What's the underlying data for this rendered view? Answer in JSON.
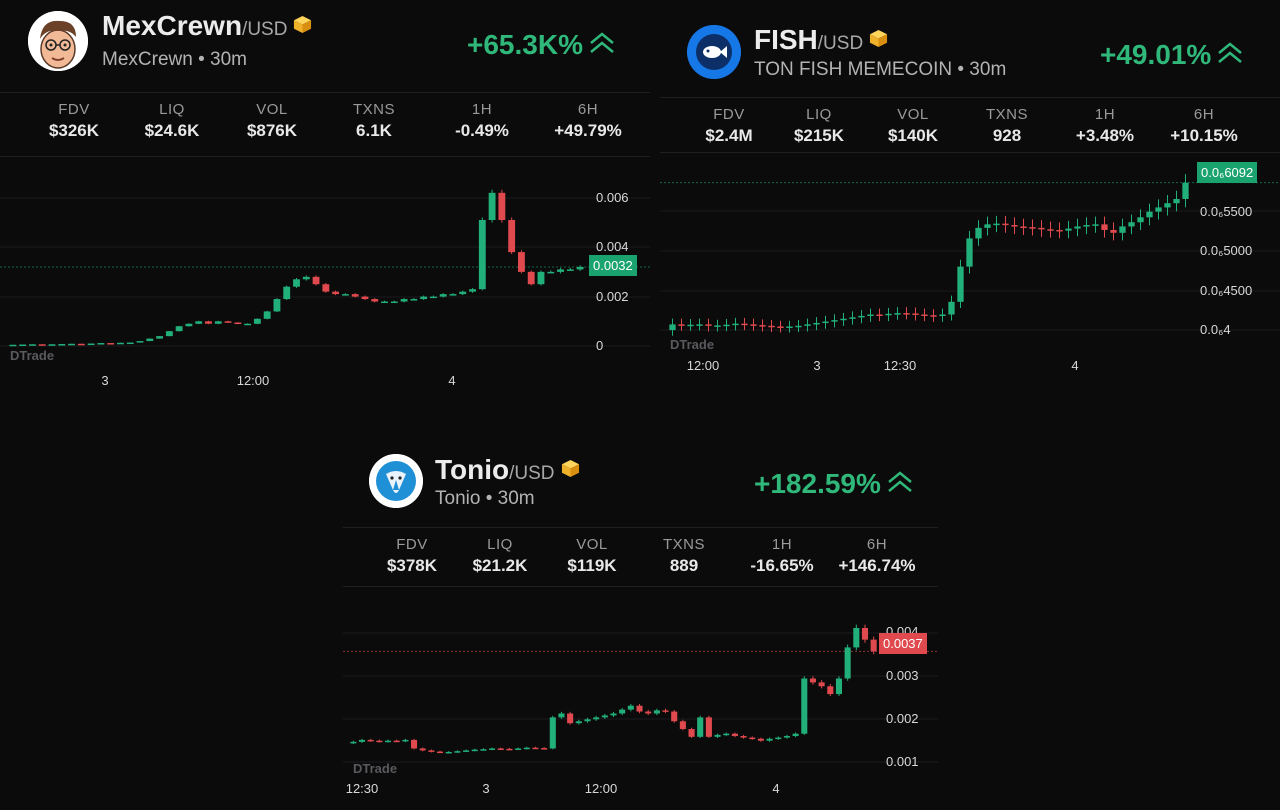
{
  "cards": [
    {
      "id": "mexcrewn",
      "name": "MexCrewn",
      "unit": "/USD",
      "subtitle": "MexCrewn • 30m",
      "change": "+65.3K%",
      "stats": [
        {
          "label": "FDV",
          "value": "$326K"
        },
        {
          "label": "LIQ",
          "value": "$24.6K"
        },
        {
          "label": "VOL",
          "value": "$876K"
        },
        {
          "label": "TXNS",
          "value": "6.1K"
        },
        {
          "label": "1H",
          "value": "-0.49%"
        },
        {
          "label": "6H",
          "value": "+49.79%"
        }
      ],
      "watermark": "DTrade",
      "price_tag": "0.0032",
      "price_tag_color": "#1aa36f",
      "y_labels": [
        "0.006",
        "0.004",
        "0.002",
        "0"
      ],
      "x_labels": [
        "3",
        "12:00",
        "4"
      ]
    },
    {
      "id": "fish",
      "name": "FISH",
      "unit": "/USD",
      "subtitle": "TON FISH MEMECOIN • 30m",
      "change": "+49.01%",
      "stats": [
        {
          "label": "FDV",
          "value": "$2.4M"
        },
        {
          "label": "LIQ",
          "value": "$215K"
        },
        {
          "label": "VOL",
          "value": "$140K"
        },
        {
          "label": "TXNS",
          "value": "928"
        },
        {
          "label": "1H",
          "value": "+3.48%"
        },
        {
          "label": "6H",
          "value": "+10.15%"
        }
      ],
      "watermark": "DTrade",
      "price_tag": "0.0₆6092",
      "price_tag_color": "#1aa36f",
      "y_labels": [
        "0.0₆5500",
        "0.0₆5000",
        "0.0₆4500",
        "0.0₆4"
      ],
      "x_labels": [
        "12:00",
        "3",
        "12:30",
        "4"
      ]
    },
    {
      "id": "tonio",
      "name": "Tonio",
      "unit": "/USD",
      "subtitle": "Tonio • 30m",
      "change": "+182.59%",
      "stats": [
        {
          "label": "FDV",
          "value": "$378K"
        },
        {
          "label": "LIQ",
          "value": "$21.2K"
        },
        {
          "label": "VOL",
          "value": "$119K"
        },
        {
          "label": "TXNS",
          "value": "889"
        },
        {
          "label": "1H",
          "value": "-16.65%"
        },
        {
          "label": "6H",
          "value": "+146.74%"
        }
      ],
      "watermark": "DTrade",
      "price_tag": "0.0037",
      "price_tag_color": "#e0494d",
      "y_labels": [
        "0.004",
        "0.003",
        "0.002",
        "0.001"
      ],
      "x_labels": [
        "12:30",
        "3",
        "12:00",
        "4"
      ]
    }
  ],
  "colors": {
    "up": "#22b07a",
    "down": "#e0494d",
    "accent": "#2fb87a",
    "background": "#0b0b0c"
  },
  "icons": {
    "verified": "gold-cube-icon",
    "trend": "double-chevron-up-icon"
  },
  "chart_data": [
    {
      "type": "candlestick",
      "title": "MexCrewn/USD",
      "ylim": [
        0,
        0.0068
      ],
      "last_price": 0.0032,
      "close": [
        5e-05,
        6e-05,
        7e-05,
        6e-05,
        7e-05,
        8e-05,
        9e-05,
        8e-05,
        0.0001,
        0.00012,
        0.00011,
        0.00013,
        0.00014,
        0.0002,
        0.0003,
        0.0004,
        0.0006,
        0.0008,
        0.0009,
        0.001,
        0.0009,
        0.001,
        0.00095,
        0.0009,
        0.0009,
        0.0011,
        0.0014,
        0.0019,
        0.0024,
        0.0027,
        0.0028,
        0.0025,
        0.0022,
        0.0021,
        0.0021,
        0.002,
        0.0019,
        0.0018,
        0.0018,
        0.0018,
        0.0019,
        0.0019,
        0.002,
        0.002,
        0.0021,
        0.0021,
        0.0022,
        0.0023,
        0.0051,
        0.0062,
        0.0051,
        0.0038,
        0.003,
        0.0025,
        0.003,
        0.003,
        0.0031,
        0.0031,
        0.0032
      ]
    },
    {
      "type": "candlestick",
      "title": "FISH/USD",
      "ylim": [
        4000,
        6300
      ],
      "last_price": 6092,
      "close": [
        4080,
        4070,
        4075,
        4080,
        4060,
        4065,
        4075,
        4090,
        4080,
        4070,
        4060,
        4050,
        4045,
        4050,
        4060,
        4080,
        4100,
        4120,
        4140,
        4160,
        4180,
        4200,
        4220,
        4210,
        4230,
        4240,
        4235,
        4220,
        4210,
        4200,
        4220,
        4400,
        4900,
        5300,
        5450,
        5500,
        5510,
        5490,
        5470,
        5460,
        5450,
        5430,
        5420,
        5410,
        5440,
        5470,
        5490,
        5500,
        5420,
        5380,
        5470,
        5530,
        5600,
        5680,
        5740,
        5800,
        5860,
        6092
      ]
    },
    {
      "type": "candlestick",
      "title": "Tonio/USD",
      "ylim": [
        0.0008,
        0.0043
      ],
      "last_price": 0.0037,
      "close": [
        0.00137,
        0.00142,
        0.0014,
        0.00138,
        0.0014,
        0.00139,
        0.00142,
        0.0012,
        0.00115,
        0.00112,
        0.0011,
        0.00111,
        0.00113,
        0.00115,
        0.00117,
        0.00118,
        0.0012,
        0.00119,
        0.00118,
        0.0012,
        0.00122,
        0.00121,
        0.0012,
        0.002,
        0.0021,
        0.00185,
        0.0019,
        0.00195,
        0.002,
        0.00205,
        0.0021,
        0.0022,
        0.0023,
        0.00215,
        0.0021,
        0.00218,
        0.00215,
        0.0019,
        0.0017,
        0.0015,
        0.002,
        0.0015,
        0.00155,
        0.00158,
        0.00152,
        0.00148,
        0.00145,
        0.0014,
        0.00145,
        0.00148,
        0.00152,
        0.00158,
        0.003,
        0.0029,
        0.0028,
        0.0026,
        0.003,
        0.0038,
        0.0043,
        0.004,
        0.0037
      ]
    }
  ]
}
